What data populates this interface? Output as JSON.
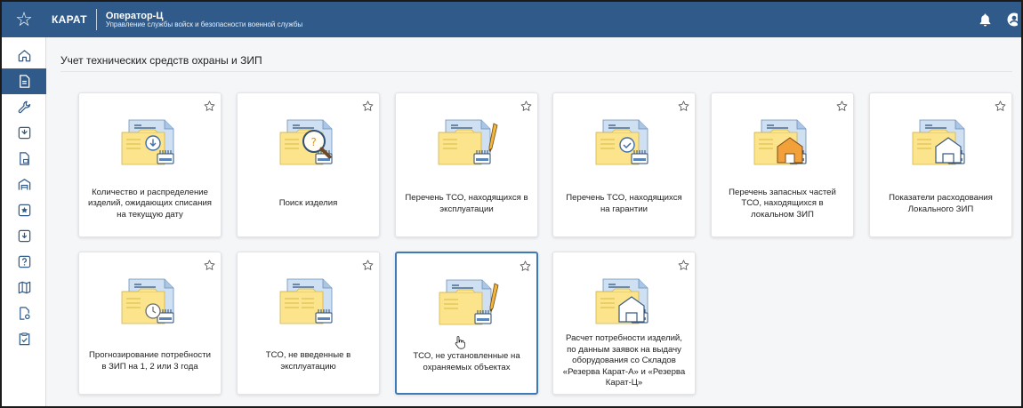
{
  "header": {
    "star_icon": "star-outline-icon",
    "logo": "КАРАТ",
    "title": "Оператор-Ц",
    "subtitle": "Управление службы войск и безопасности военной службы",
    "bell_icon": "bell-icon",
    "user_icon": "user-circle-icon",
    "color": "#2f5a8a"
  },
  "sidebar": {
    "items": [
      {
        "icon": "home-icon"
      },
      {
        "icon": "document-icon",
        "active": true
      },
      {
        "icon": "wrench-icon"
      },
      {
        "icon": "shield-arrow-icon"
      },
      {
        "icon": "document-stack-icon"
      },
      {
        "icon": "warehouse-icon"
      },
      {
        "icon": "star-badge-icon"
      },
      {
        "icon": "download-icon"
      },
      {
        "icon": "question-icon"
      },
      {
        "icon": "map-icon"
      },
      {
        "icon": "document-settings-icon"
      },
      {
        "icon": "clipboard-check-icon"
      }
    ]
  },
  "main": {
    "title": "Учет технических средств охраны и ЗИП",
    "cards": [
      {
        "label": "Количество и распределение изделий, ожидающих списания на текущую дату",
        "icon": "download-card-icon"
      },
      {
        "label": "Поиск изделия",
        "icon": "search-card-icon"
      },
      {
        "label": "Перечень ТСО, находящихся в эксплуатации",
        "icon": "pencil-card-icon"
      },
      {
        "label": "Перечень ТСО, находящихся на гарантии",
        "icon": "check-card-icon"
      },
      {
        "label": "Перечень запасных частей ТСО, находящихся в локальном ЗИП",
        "icon": "warehouse-card-icon"
      },
      {
        "label": "Показатели расходования Локального ЗИП",
        "icon": "warehouse-outline-card-icon"
      },
      {
        "label": "Прогнозирование потребности в ЗИП на 1, 2 или 3 года",
        "icon": "clock-card-icon"
      },
      {
        "label": "ТСО, не введенные в эксплуатацию",
        "icon": "list-card-icon"
      },
      {
        "label": "ТСО, не установленные на охраняемых объектах",
        "icon": "pencil-card-icon",
        "selected": true
      },
      {
        "label": "Расчет потребности изделий, по данным заявок на выдачу оборудования со Складов «Резерва Карат-А» и «Резерва Карат-Ц»",
        "icon": "warehouse-outline-card-icon"
      }
    ]
  }
}
